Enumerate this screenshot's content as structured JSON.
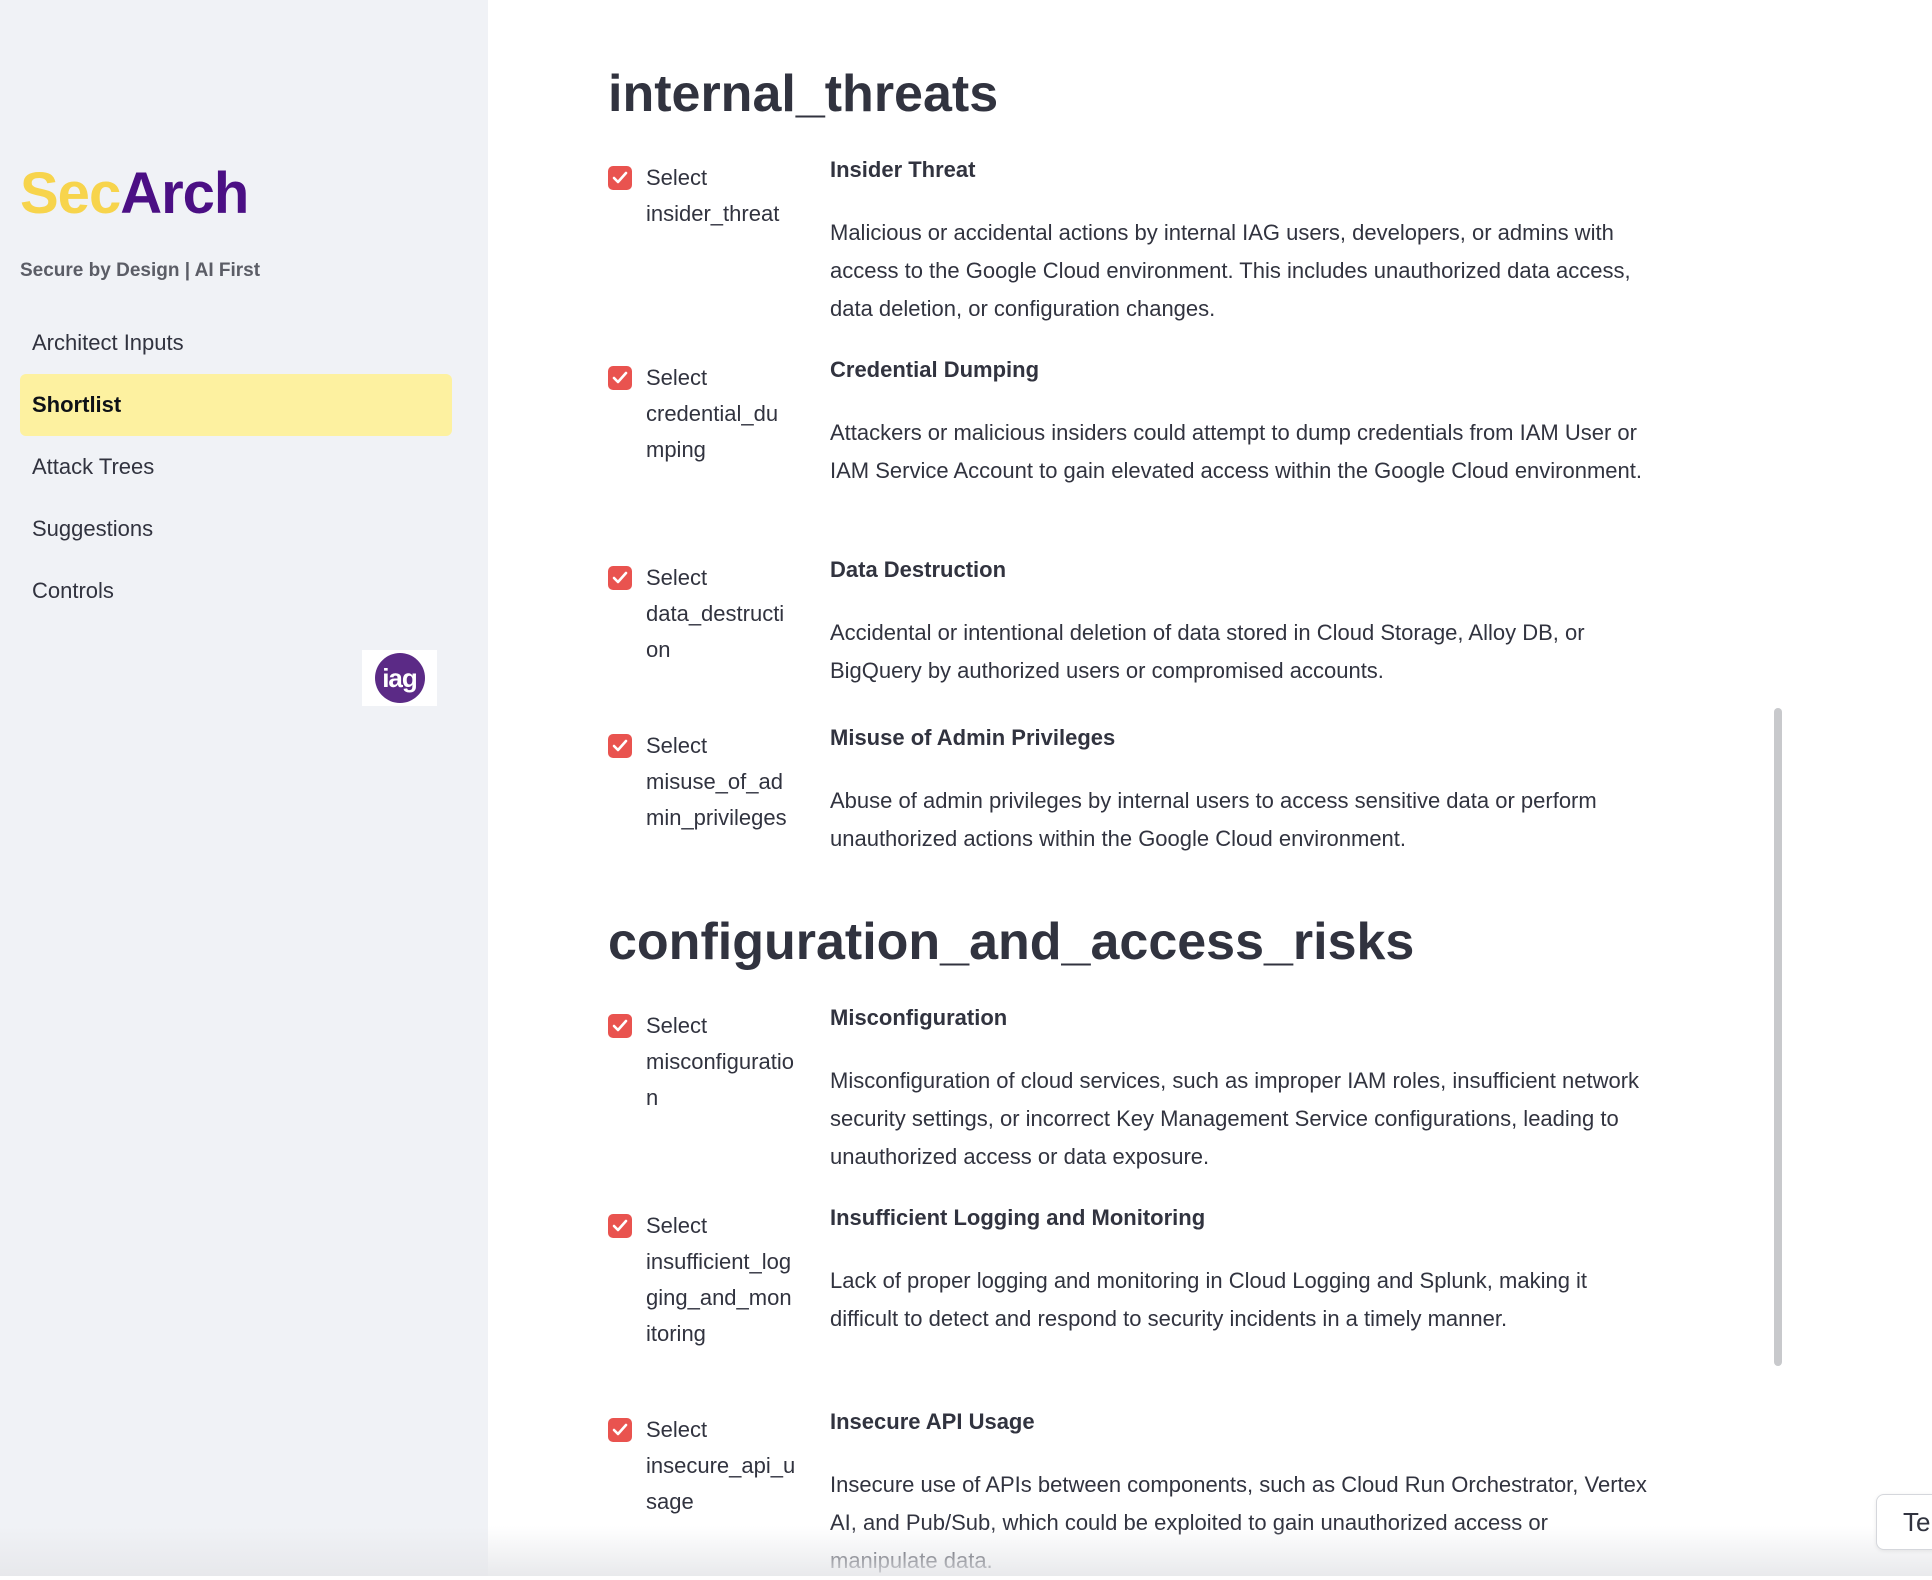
{
  "sidebar": {
    "brand_sec": "Sec",
    "brand_arch": "Arch",
    "tagline": "Secure by Design | AI First",
    "nav": [
      {
        "label": "Architect Inputs"
      },
      {
        "label": "Shortlist",
        "active": true
      },
      {
        "label": "Attack Trees"
      },
      {
        "label": "Suggestions"
      },
      {
        "label": "Controls"
      }
    ],
    "logo_text": "iag"
  },
  "sections": [
    {
      "title": "internal_threats",
      "items": [
        {
          "select_prefix": "Select",
          "key": "insider_threat",
          "checked": true,
          "title": "Insider Threat",
          "description": "Malicious or accidental actions by internal IAG users, developers, or admins with access to the Google Cloud environment. This includes unauthorized data access, data deletion, or configuration changes."
        },
        {
          "select_prefix": "Select",
          "key": "credential_dumping",
          "checked": true,
          "title": "Credential Dumping",
          "description": "Attackers or malicious insiders could attempt to dump credentials from IAM User or IAM Service Account to gain elevated access within the Google Cloud environment."
        },
        {
          "select_prefix": "Select",
          "key": "data_destruction",
          "checked": true,
          "title": "Data Destruction",
          "description": "Accidental or intentional deletion of data stored in Cloud Storage, Alloy DB, or BigQuery by authorized users or compromised accounts."
        },
        {
          "select_prefix": "Select",
          "key": "misuse_of_admin_privileges",
          "checked": true,
          "title": "Misuse of Admin Privileges",
          "description": "Abuse of admin privileges by internal users to access sensitive data or perform unauthorized actions within the Google Cloud environment."
        }
      ]
    },
    {
      "title": "configuration_and_access_risks",
      "items": [
        {
          "select_prefix": "Select",
          "key": "misconfiguration",
          "checked": true,
          "title": "Misconfiguration",
          "description": "Misconfiguration of cloud services, such as improper IAM roles, insufficient network security settings, or incorrect Key Management Service configurations, leading to unauthorized access or data exposure."
        },
        {
          "select_prefix": "Select",
          "key": "insufficient_logging_and_monitoring",
          "checked": true,
          "title": "Insufficient Logging and Monitoring",
          "description": "Lack of proper logging and monitoring in Cloud Logging and Splunk, making it difficult to detect and respond to security incidents in a timely manner."
        },
        {
          "select_prefix": "Select",
          "key": "insecure_api_usage",
          "checked": true,
          "title": "Insecure API Usage",
          "description": "Insecure use of APIs between components, such as Cloud Run Orchestrator, Vertex AI, and Pub/Sub, which could be exploited to gain unauthorized access or manipulate data."
        }
      ]
    }
  ],
  "corner_button": "Te",
  "colors": {
    "accent_check": "#e9534f",
    "brand_yellow": "#f7d44c",
    "brand_purple": "#4b0f84",
    "active_nav_bg": "#fdf1a0",
    "sidebar_bg": "#f0f2f6"
  }
}
